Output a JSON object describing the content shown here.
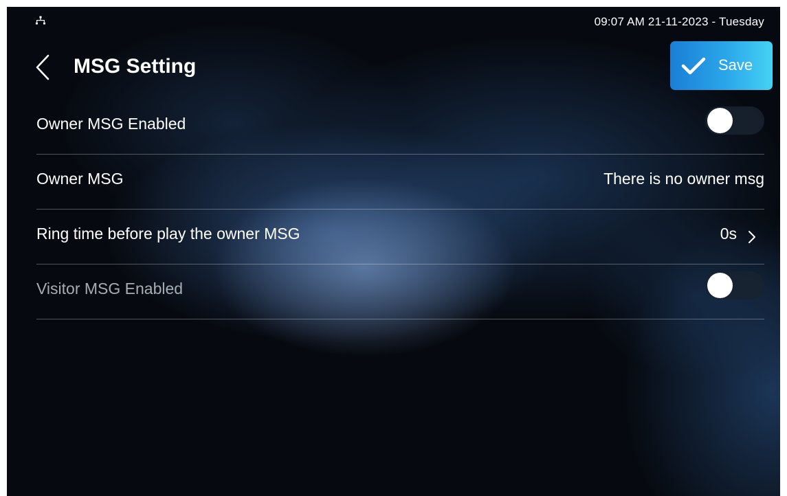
{
  "status_bar": {
    "network_icon": "network-icon",
    "datetime": "09:07 AM  21-11-2023 - Tuesday"
  },
  "header": {
    "back_icon": "chevron-left-icon",
    "title": "MSG Setting",
    "save_icon": "checkmark-icon",
    "save_label": "Save"
  },
  "settings": {
    "owner_msg_enabled": {
      "label": "Owner MSG Enabled",
      "enabled": false
    },
    "owner_msg": {
      "label": "Owner MSG",
      "value": "There is no owner msg"
    },
    "ring_time": {
      "label": "Ring time before play the owner MSG",
      "value": "0s",
      "icon": "chevron-right-icon"
    },
    "visitor_msg_enabled": {
      "label": "Visitor MSG Enabled",
      "enabled": false
    }
  },
  "colors": {
    "accent_start": "#1a7fd6",
    "accent_end": "#45d2f3",
    "background": "#06090f",
    "divider": "rgba(255,255,255,0.30)",
    "dim_text": "#a8adb4"
  }
}
